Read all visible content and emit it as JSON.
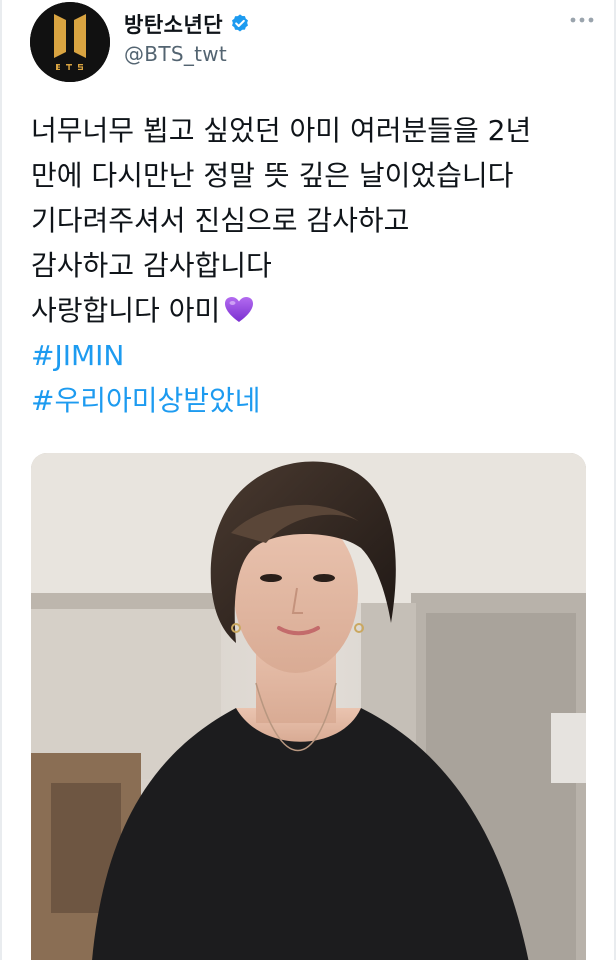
{
  "account": {
    "display_name": "방탄소년단",
    "handle": "@BTS_twt",
    "avatar_logo_text": "BTS",
    "verified": true
  },
  "tweet": {
    "lines": [
      "너무너무 뵙고 싶었던 아미 여러분들을 2년",
      "만에 다시만난 정말 뜻 깊은 날이었습니다",
      "기다려주셔서 진심으로 감사하고",
      "감사하고 감사합니다",
      "사랑합니다 아미"
    ],
    "emoji": "purple-heart",
    "hashtags": [
      "#JIMIN",
      "#우리아미상받았네"
    ]
  },
  "colors": {
    "text": "#0f1419",
    "secondary": "#536471",
    "link": "#1d9bf0",
    "verified": "#1d9bf0",
    "logo_gold": "#d9a441"
  },
  "icons": {
    "verified": "verified-badge-icon",
    "more": "more-options-icon",
    "heart": "purple-heart-icon"
  }
}
